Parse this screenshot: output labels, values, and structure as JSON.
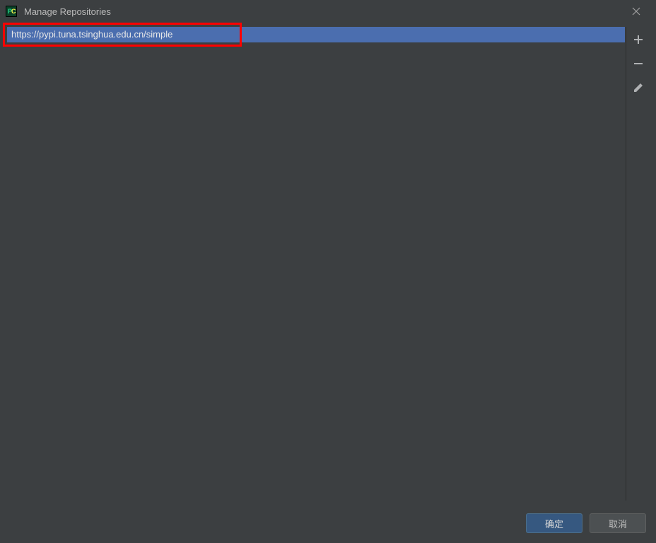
{
  "titlebar": {
    "title": "Manage Repositories"
  },
  "repositories": {
    "items": [
      {
        "url": "https://pypi.tuna.tsinghua.edu.cn/simple",
        "selected": true
      }
    ]
  },
  "toolbar": {
    "add": "plus-icon",
    "remove": "minus-icon",
    "edit": "pencil-icon"
  },
  "buttons": {
    "ok": "确定",
    "cancel": "取消"
  }
}
